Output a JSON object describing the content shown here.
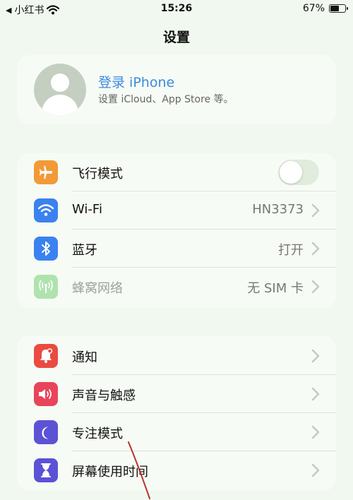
{
  "status": {
    "back_app": "小红书",
    "time": "15:26",
    "battery_pct": "67%",
    "battery_level": 0.67
  },
  "title": "设置",
  "profile": {
    "name": "登录 iPhone",
    "subtitle": "设置 iCloud、App Store 等。"
  },
  "group1": [
    {
      "label": "飞行模式",
      "icon": "airplane-icon",
      "color": "#f19a37",
      "toggle": false
    },
    {
      "label": "Wi-Fi",
      "value": "HN3373",
      "icon": "wifi-icon",
      "color": "#3b82f0"
    },
    {
      "label": "蓝牙",
      "value": "打开",
      "icon": "bluetooth-icon",
      "color": "#3b82f0"
    },
    {
      "label": "蜂窝网络",
      "value": "无 SIM 卡",
      "icon": "cellular-icon",
      "color": "#5ac85a",
      "disabled": true
    }
  ],
  "group2": [
    {
      "label": "通知",
      "icon": "notification-bell-icon",
      "color": "#ea4b41"
    },
    {
      "label": "声音与触感",
      "icon": "speaker-icon",
      "color": "#e8455a"
    },
    {
      "label": "专注模式",
      "icon": "moon-icon",
      "color": "#5b52d6"
    },
    {
      "label": "屏幕使用时间",
      "icon": "hourglass-icon",
      "color": "#5b52d6"
    }
  ],
  "colors": {
    "background": "#f1f8ef",
    "card": "#f7fbf5",
    "accent_link": "#3a8ae0",
    "chevron": "#c3cbc2",
    "annotation_stroke": "#b8332a"
  }
}
